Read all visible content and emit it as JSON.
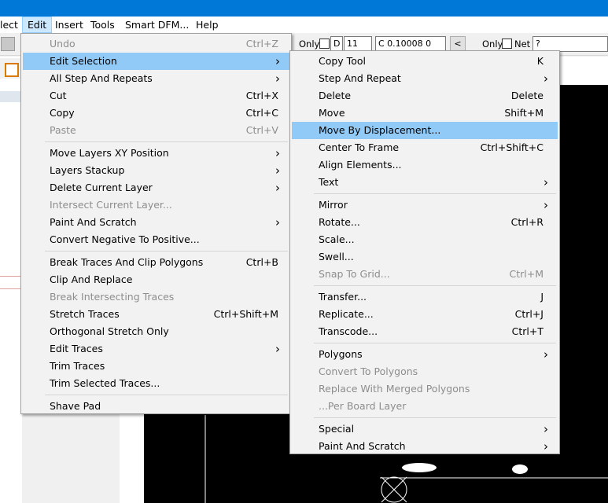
{
  "menubar": {
    "items": [
      "lect",
      "Edit",
      "Insert",
      "Tools",
      "Smart DFM...",
      "Help"
    ]
  },
  "toolbar": {
    "only1": "Only",
    "d_label": "D",
    "d_value": "11",
    "coord": "C 0.10008  0",
    "nav_left": "<",
    "only2": "Only",
    "net_label": "Net",
    "net_value": "?"
  },
  "edit_menu": [
    {
      "label": "Undo",
      "shortcut": "Ctrl+Z",
      "disabled": true
    },
    {
      "label": "Edit Selection",
      "submenu": true,
      "highlighted": true
    },
    {
      "label": "All Step And Repeats",
      "submenu": true
    },
    {
      "label": "Cut",
      "shortcut": "Ctrl+X"
    },
    {
      "label": "Copy",
      "shortcut": "Ctrl+C"
    },
    {
      "label": "Paste",
      "shortcut": "Ctrl+V",
      "disabled": true
    },
    {
      "separator": true
    },
    {
      "label": "Move Layers XY Position",
      "submenu": true
    },
    {
      "label": "Layers Stackup",
      "submenu": true
    },
    {
      "label": "Delete Current Layer",
      "submenu": true
    },
    {
      "label": "Intersect Current Layer...",
      "disabled": true
    },
    {
      "label": "Paint And Scratch",
      "submenu": true
    },
    {
      "label": "Convert Negative To Positive..."
    },
    {
      "separator": true
    },
    {
      "label": "Break Traces And Clip Polygons",
      "shortcut": "Ctrl+B"
    },
    {
      "label": "Clip And Replace"
    },
    {
      "label": "Break Intersecting Traces",
      "disabled": true
    },
    {
      "label": "Stretch Traces",
      "shortcut": "Ctrl+Shift+M"
    },
    {
      "label": "Orthogonal Stretch Only"
    },
    {
      "label": "Edit Traces",
      "submenu": true
    },
    {
      "label": "Trim Traces"
    },
    {
      "label": "Trim Selected Traces..."
    },
    {
      "separator": true
    },
    {
      "label": "Shave Pad"
    }
  ],
  "selection_menu": [
    {
      "label": "Copy Tool",
      "shortcut": "K"
    },
    {
      "label": "Step And Repeat",
      "submenu": true
    },
    {
      "label": "Delete",
      "shortcut": "Delete"
    },
    {
      "label": "Move",
      "shortcut": "Shift+M"
    },
    {
      "label": "Move By Displacement...",
      "highlighted": true
    },
    {
      "label": "Center To Frame",
      "shortcut": "Ctrl+Shift+C"
    },
    {
      "label": "Align Elements..."
    },
    {
      "label": "Text",
      "submenu": true
    },
    {
      "separator": true
    },
    {
      "label": "Mirror",
      "submenu": true
    },
    {
      "label": "Rotate...",
      "shortcut": "Ctrl+R"
    },
    {
      "label": "Scale..."
    },
    {
      "label": "Swell..."
    },
    {
      "label": "Snap To Grid...",
      "shortcut": "Ctrl+M",
      "disabled": true
    },
    {
      "separator": true
    },
    {
      "label": "Transfer...",
      "shortcut": "J"
    },
    {
      "label": "Replicate...",
      "shortcut": "Ctrl+J"
    },
    {
      "label": "Transcode...",
      "shortcut": "Ctrl+T"
    },
    {
      "separator": true
    },
    {
      "label": "Polygons",
      "submenu": true
    },
    {
      "label": "Convert To Polygons",
      "disabled": true
    },
    {
      "label": "Replace With Merged Polygons",
      "disabled": true
    },
    {
      "label": "...Per Board Layer",
      "disabled": true
    },
    {
      "separator": true
    },
    {
      "label": "Special",
      "submenu": true
    },
    {
      "label": "Paint And Scratch",
      "submenu": true
    }
  ]
}
